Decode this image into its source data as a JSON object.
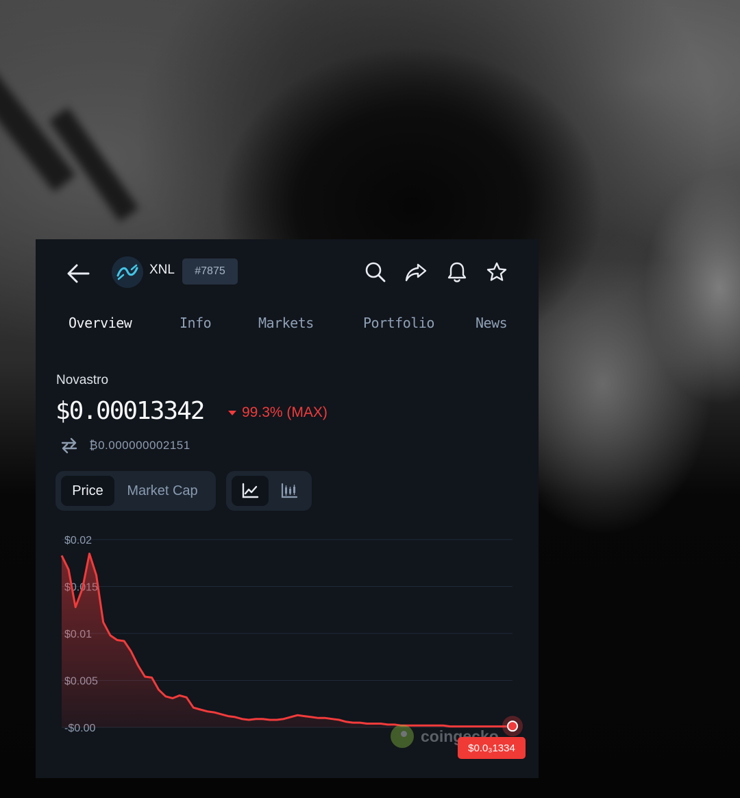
{
  "header": {
    "ticker": "XNL",
    "rank": "#7875"
  },
  "tabs": [
    {
      "label": "Overview",
      "active": true
    },
    {
      "label": "Info",
      "active": false
    },
    {
      "label": "Markets",
      "active": false
    },
    {
      "label": "Portfolio",
      "active": false
    },
    {
      "label": "News",
      "active": false
    }
  ],
  "coin": {
    "name": "Novastro",
    "price": "$0.00013342",
    "change": "99.3% (MAX)",
    "btc_price": "₿0.000000002151"
  },
  "metric_toggle": {
    "options": [
      "Price",
      "Market Cap"
    ],
    "selected": "Price"
  },
  "chart_style_toggle": {
    "options": [
      "line-chart-icon",
      "candlestick-icon"
    ],
    "selected": "line-chart-icon"
  },
  "watermark": "coingecko",
  "current_price_tag": "$0.0₃1334",
  "colors": {
    "panel_bg": "#11151c",
    "accent_negative": "#f23b3b",
    "gridline": "#1e2a38"
  },
  "chart_data": {
    "type": "area",
    "title": "",
    "xlabel": "",
    "ylabel": "",
    "ylim": [
      0,
      0.02
    ],
    "y_tick_labels": [
      "$0.02",
      "$0.015",
      "$0.01",
      "$0.005",
      "-$0.00"
    ],
    "grid": true,
    "series": [
      {
        "color": "#f23b3b",
        "values": [
          0.0183,
          0.0168,
          0.0128,
          0.0148,
          0.0185,
          0.0162,
          0.0112,
          0.0098,
          0.0093,
          0.0092,
          0.0081,
          0.0066,
          0.0054,
          0.0053,
          0.004,
          0.0033,
          0.0031,
          0.0034,
          0.0032,
          0.0021,
          0.0019,
          0.0017,
          0.0016,
          0.0014,
          0.0012,
          0.0011,
          0.0009,
          0.0008,
          0.0009,
          0.0009,
          0.0008,
          0.0008,
          0.0009,
          0.0011,
          0.0013,
          0.0012,
          0.0011,
          0.001,
          0.001,
          0.0009,
          0.0008,
          0.0006,
          0.0005,
          0.0005,
          0.0004,
          0.0004,
          0.0004,
          0.0003,
          0.0003,
          0.0002,
          0.0002,
          0.0002,
          0.0002,
          0.0002,
          0.0002,
          0.0002,
          0.0001,
          0.0001,
          0.0001,
          0.0001,
          0.0001,
          0.0001,
          0.0001,
          0.0001,
          0.0001,
          0.00013342
        ]
      }
    ]
  }
}
